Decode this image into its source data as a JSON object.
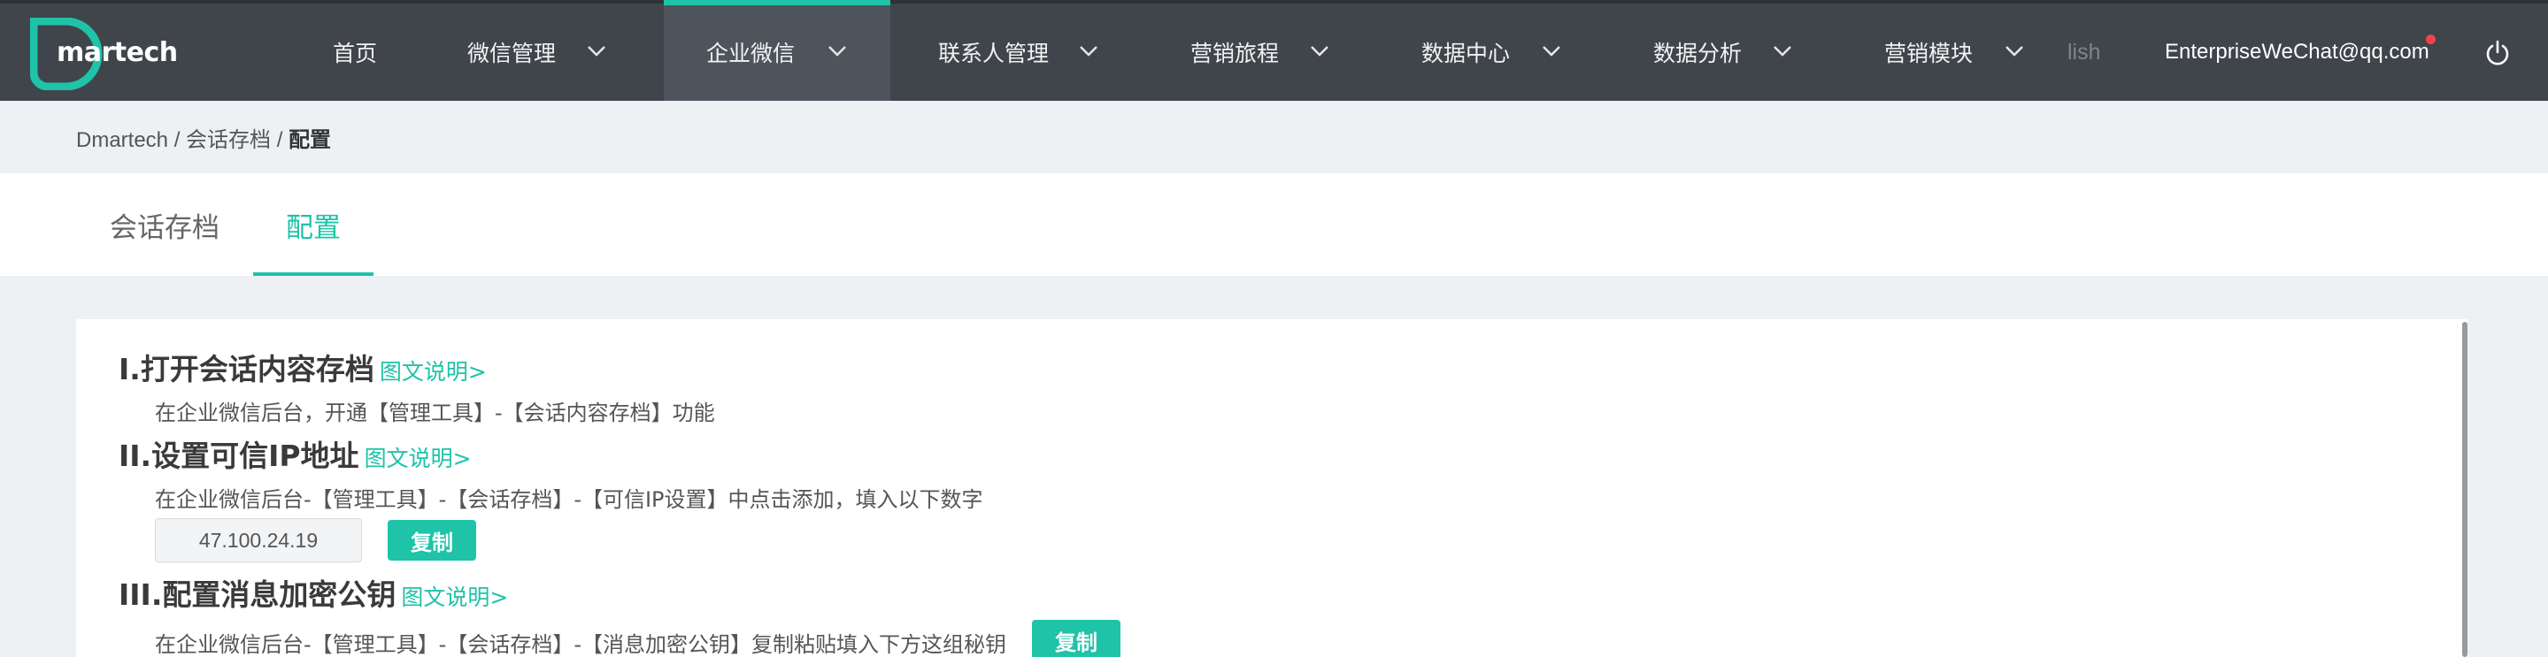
{
  "app": {
    "logo_text": "martech",
    "brand_color": "#1ec3a8"
  },
  "nav": {
    "items": [
      {
        "label": "首页"
      },
      {
        "label": "微信管理"
      },
      {
        "label": "企业微信"
      },
      {
        "label": "联系人管理"
      },
      {
        "label": "营销旅程"
      },
      {
        "label": "数据中心"
      },
      {
        "label": "数据分析"
      },
      {
        "label": "营销模块"
      },
      {
        "label": "lish"
      }
    ],
    "active_index": 2,
    "user_email": "EnterpriseWeChat@qq.com",
    "icons": [
      "chevron-down-icon",
      "power-icon"
    ]
  },
  "breadcrumb": {
    "root": "Dmartech",
    "sep1": " / ",
    "parent": "会话存档",
    "sep2": " / ",
    "current": "配置"
  },
  "tabs": [
    {
      "label": "会话存档"
    },
    {
      "label": "配置"
    }
  ],
  "steps": [
    {
      "title": "I.打开会话内容存档",
      "link": "图文说明>",
      "desc": "在企业微信后台，开通【管理工具】-【会话内容存档】功能"
    },
    {
      "title": "II.设置可信IP地址",
      "link": "图文说明>",
      "desc": "在企业微信后台-【管理工具】-【会话存档】-【可信IP设置】中点击添加，填入以下数字",
      "ip_value": "47.100.24.19",
      "copy_label": "复制"
    },
    {
      "title": "III.配置消息加密公钥",
      "link": "图文说明>",
      "desc": "在企业微信后台-【管理工具】-【会话存档】-【消息加密公钥】复制粘贴填入下方这组秘钥",
      "copy_label": "复制"
    }
  ]
}
